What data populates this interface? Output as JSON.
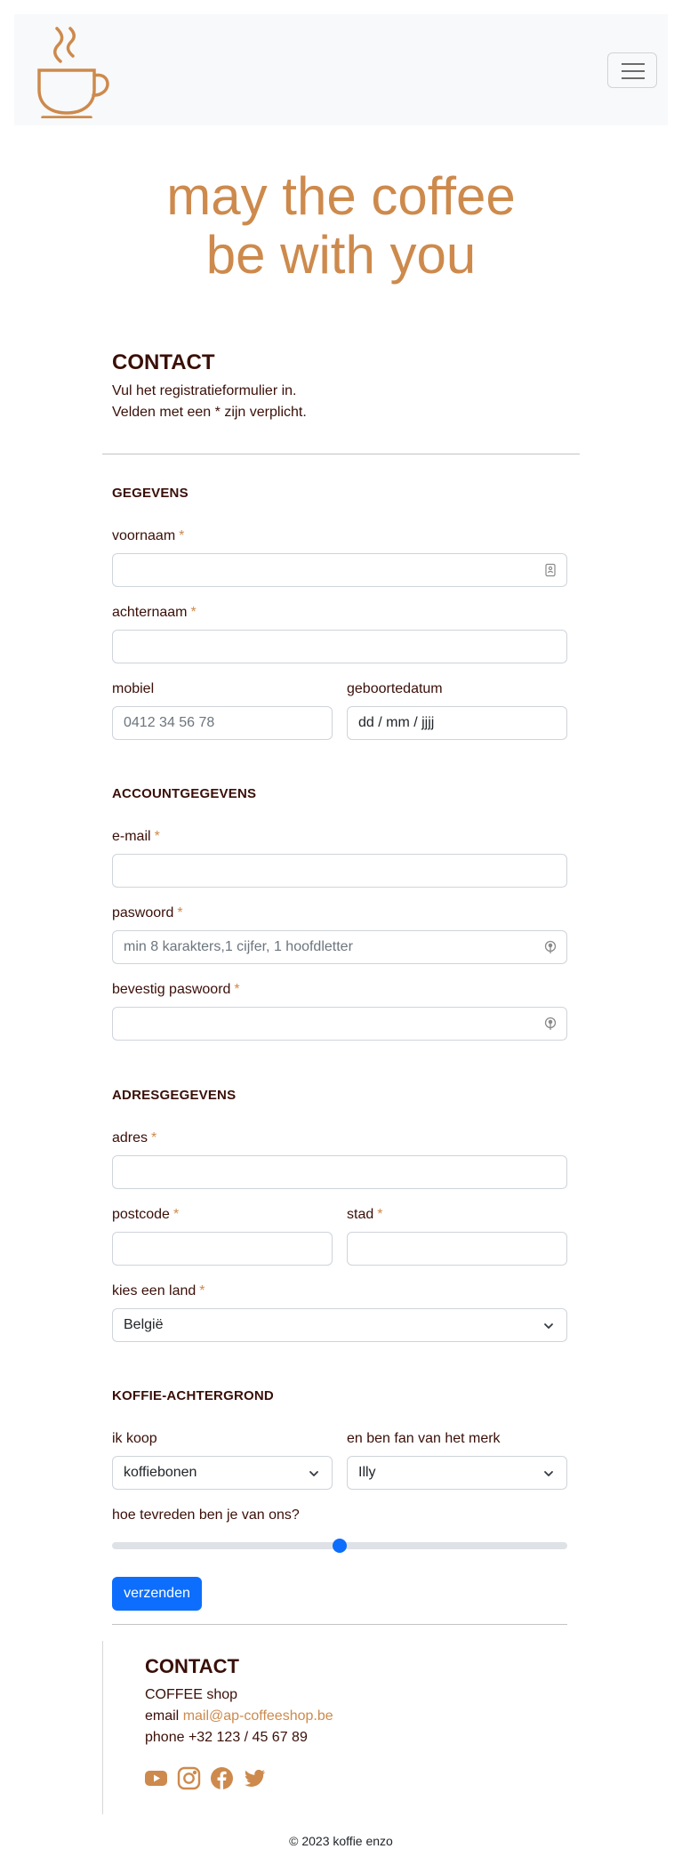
{
  "header": {
    "logo_icon": "coffee-cup-icon",
    "menu_icon": "hamburger-menu-icon"
  },
  "hero": {
    "line1": "may the coffee",
    "line2": "be with you"
  },
  "intro": {
    "title": "CONTACT",
    "line1": "Vul het registratieformulier in.",
    "line2": "Velden met een * zijn verplicht."
  },
  "required_mark": "*",
  "gegevens": {
    "title": "GEGEVENS",
    "voornaam_label": "voornaam",
    "achternaam_label": "achternaam",
    "mobiel_label": "mobiel",
    "mobiel_placeholder": "0412 34 56 78",
    "geboortedatum_label": "geboortedatum",
    "geboortedatum_value": "dd / mm / jjjj"
  },
  "account": {
    "title": "ACCOUNTGEGEVENS",
    "email_label": "e-mail",
    "paswoord_label": "paswoord",
    "paswoord_placeholder": "min 8 karakters,1 cijfer, 1 hoofdletter",
    "bevestig_label": "bevestig paswoord"
  },
  "adres": {
    "title": "ADRESGEGEVENS",
    "adres_label": "adres",
    "postcode_label": "postcode",
    "stad_label": "stad",
    "land_label": "kies een land",
    "land_value": "België"
  },
  "koffie": {
    "title": "KOFFIE-ACHTERGROND",
    "koop_label": "ik koop",
    "koop_value": "koffiebonen",
    "merk_label": "en ben fan van het merk",
    "merk_value": "Illy",
    "tevreden_label": "hoe tevreden ben je van ons?",
    "tevreden_level": 0.5
  },
  "submit_label": "verzenden",
  "footer": {
    "title": "CONTACT",
    "shop": "COFFEE shop",
    "email_prefix": "email",
    "email": "mail@ap-coffeeshop.be",
    "phone": "phone +32 123 / 45 67 89",
    "social_icons": [
      "youtube-icon",
      "instagram-icon",
      "facebook-icon",
      "twitter-icon"
    ],
    "copyright": "© 2023 koffie enzo"
  },
  "colors": {
    "accent": "#cd8a4c",
    "text": "#3a0f08",
    "primary": "#0d6efd"
  }
}
